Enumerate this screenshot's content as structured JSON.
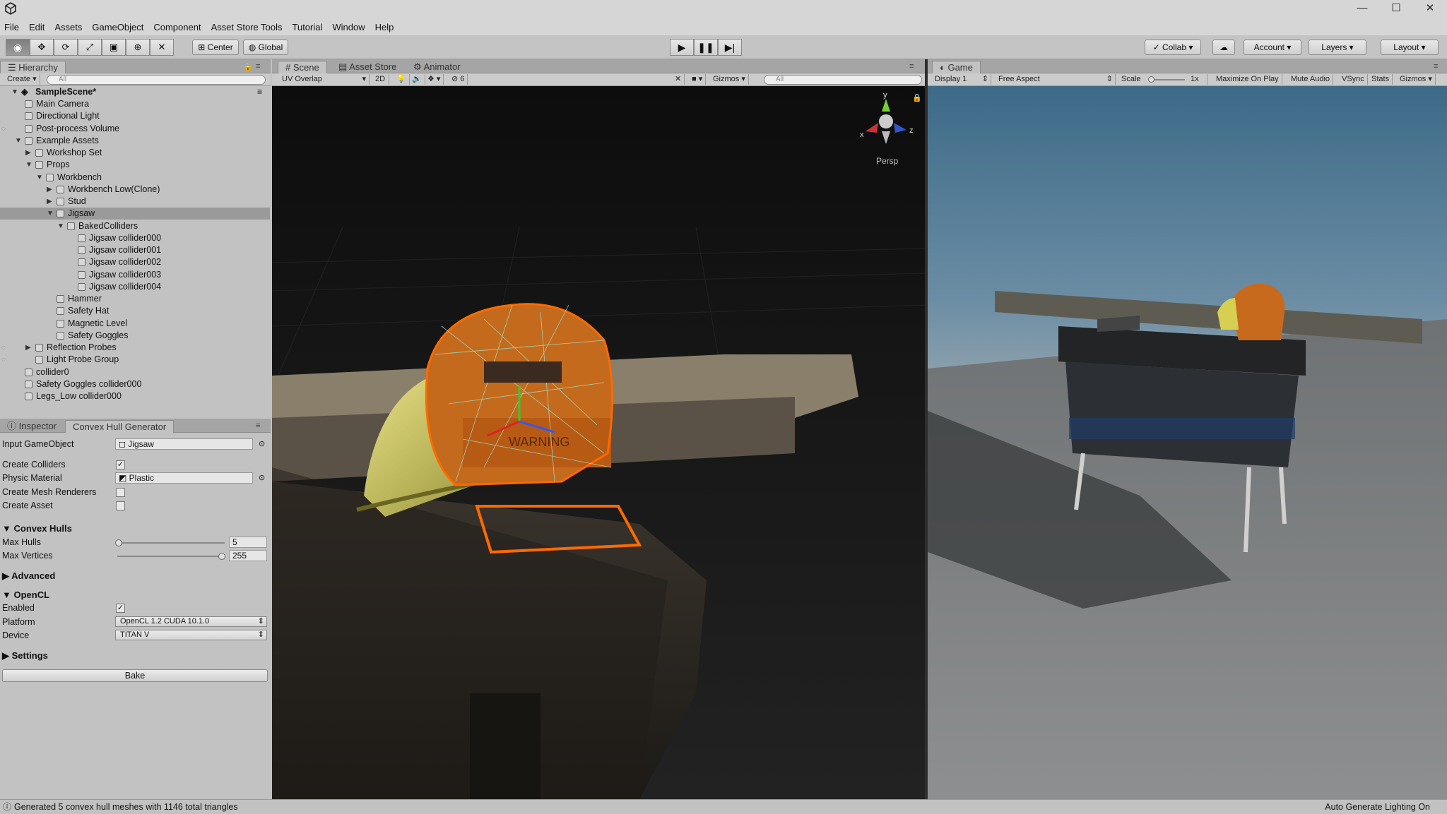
{
  "window": {
    "minimize": "—",
    "maximize": "☐",
    "close": "✕"
  },
  "menu": [
    "File",
    "Edit",
    "Assets",
    "GameObject",
    "Component",
    "Asset Store Tools",
    "Tutorial",
    "Window",
    "Help"
  ],
  "toolbar": {
    "pivot": "Center",
    "space": "Global",
    "collab": "Collab",
    "account": "Account",
    "layers": "Layers",
    "layout": "Layout"
  },
  "hierarchy": {
    "tab": "Hierarchy",
    "create": "Create",
    "search_placeholder": "All",
    "scene": "SampleScene*",
    "items": [
      {
        "label": "Main Camera"
      },
      {
        "label": "Directional Light"
      },
      {
        "label": "Post-process Volume"
      },
      {
        "label": "Example Assets"
      },
      {
        "label": "Workshop Set"
      },
      {
        "label": "Props"
      },
      {
        "label": "Workbench"
      },
      {
        "label": "Workbench Low(Clone)"
      },
      {
        "label": "Stud"
      },
      {
        "label": "Jigsaw"
      },
      {
        "label": "BakedColliders"
      },
      {
        "label": "Jigsaw collider000"
      },
      {
        "label": "Jigsaw collider001"
      },
      {
        "label": "Jigsaw collider002"
      },
      {
        "label": "Jigsaw collider003"
      },
      {
        "label": "Jigsaw collider004"
      },
      {
        "label": "Hammer"
      },
      {
        "label": "Safety Hat"
      },
      {
        "label": "Magnetic Level"
      },
      {
        "label": "Safety Goggles"
      },
      {
        "label": "Reflection Probes"
      },
      {
        "label": "Light Probe Group"
      },
      {
        "label": "collider0"
      },
      {
        "label": "Safety Goggles collider000"
      },
      {
        "label": "Legs_Low collider000"
      }
    ]
  },
  "inspector": {
    "tab_inspector": "Inspector",
    "tab_generator": "Convex Hull Generator",
    "input_label": "Input GameObject",
    "input_value": "Jigsaw",
    "create_colliders": "Create Colliders",
    "physic_material_label": "Physic Material",
    "physic_material_value": "Plastic",
    "create_mesh_renderers": "Create Mesh Renderers",
    "create_asset": "Create Asset",
    "convex_hulls": "Convex Hulls",
    "max_hulls_label": "Max Hulls",
    "max_hulls_value": "5",
    "max_vertices_label": "Max Vertices",
    "max_vertices_value": "255",
    "advanced": "Advanced",
    "opencl": "OpenCL",
    "enabled_label": "Enabled",
    "platform_label": "Platform",
    "platform_value": "OpenCL 1.2 CUDA 10.1.0",
    "device_label": "Device",
    "device_value": "TITAN V",
    "settings": "Settings",
    "bake": "Bake"
  },
  "scene": {
    "tab_scene": "Scene",
    "tab_store": "Asset Store",
    "tab_animator": "Animator",
    "shading": "UV Overlap",
    "mode2d": "2D",
    "fx_count": "6",
    "gizmos": "Gizmos",
    "search_placeholder": "All",
    "persp": "Persp",
    "axis_y": "y",
    "axis_x": "x",
    "axis_z": "z",
    "warning": "WARNING"
  },
  "game": {
    "tab": "Game",
    "display": "Display 1",
    "aspect": "Free Aspect",
    "scale_label": "Scale",
    "scale_value": "1x",
    "maximize": "Maximize On Play",
    "mute": "Mute Audio",
    "vsync": "VSync",
    "stats": "Stats",
    "gizmos": "Gizmos"
  },
  "status": {
    "message": "Generated 5 convex hull meshes with 1146 total triangles",
    "right": "Auto Generate Lighting On"
  },
  "colors": {
    "selection": "#9a9a9a",
    "hull_outline": "#ff6a00"
  }
}
